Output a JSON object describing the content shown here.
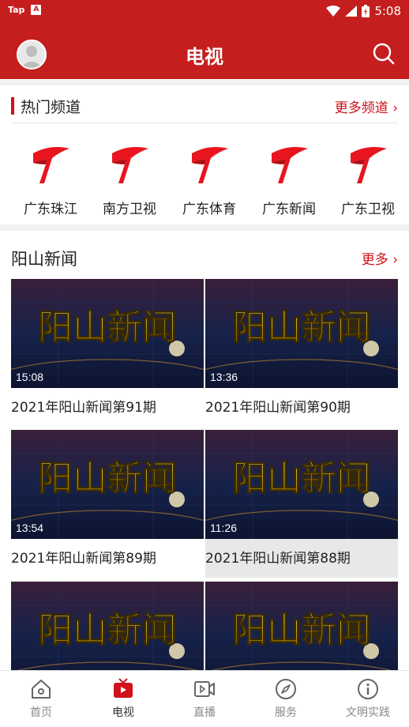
{
  "status": {
    "carrier": "Tap",
    "app_badge": "A",
    "time": "5:08"
  },
  "header": {
    "title": "电视"
  },
  "hot_channels": {
    "title": "热门频道",
    "more": "更多频道 ›",
    "items": [
      {
        "name": "广东珠江"
      },
      {
        "name": "南方卫视"
      },
      {
        "name": "广东体育"
      },
      {
        "name": "广东新闻"
      },
      {
        "name": "广东卫视"
      }
    ]
  },
  "news": {
    "title": "阳山新闻",
    "more": "更多 ›",
    "thumb_text": "阳山新闻",
    "items": [
      {
        "duration": "15:08",
        "caption": "2021年阳山新闻第91期"
      },
      {
        "duration": "13:36",
        "caption": "2021年阳山新闻第90期"
      },
      {
        "duration": "13:54",
        "caption": "2021年阳山新闻第89期"
      },
      {
        "duration": "11:26",
        "caption": "2021年阳山新闻第88期"
      },
      {
        "duration": "",
        "caption": ""
      },
      {
        "duration": "",
        "caption": ""
      }
    ]
  },
  "tabs": [
    {
      "label": "首页",
      "icon": "home-icon"
    },
    {
      "label": "电视",
      "icon": "tv-icon",
      "active": true
    },
    {
      "label": "直播",
      "icon": "live-icon"
    },
    {
      "label": "服务",
      "icon": "compass-icon"
    },
    {
      "label": "文明实践",
      "icon": "info-icon"
    }
  ],
  "colors": {
    "brand": "#c41e1e",
    "accent": "#d0121b"
  }
}
